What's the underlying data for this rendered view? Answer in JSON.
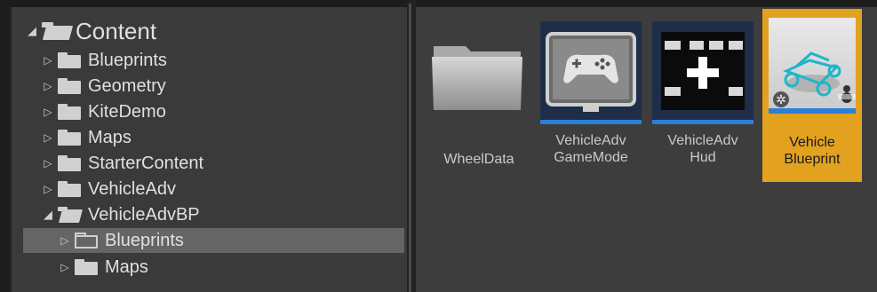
{
  "tree": {
    "root": {
      "label": "Content"
    },
    "items": [
      {
        "label": "Blueprints"
      },
      {
        "label": "Geometry"
      },
      {
        "label": "KiteDemo"
      },
      {
        "label": "Maps"
      },
      {
        "label": "StarterContent"
      },
      {
        "label": "VehicleAdv"
      },
      {
        "label": "VehicleAdvBP"
      }
    ],
    "sub_items": [
      {
        "label": "Blueprints"
      },
      {
        "label": "Maps"
      }
    ]
  },
  "assets": [
    {
      "label": "WheelData",
      "icon": "folder-icon"
    },
    {
      "label_line1": "VehicleAdv",
      "label_line2": "GameMode",
      "icon": "gamepad-icon"
    },
    {
      "label_line1": "VehicleAdv",
      "label_line2": "Hud",
      "icon": "hud-icon"
    },
    {
      "label_line1": "Vehicle",
      "label_line2": "Blueprint",
      "icon": "vehicle-icon"
    }
  ],
  "colors": {
    "selection": "#e2a11e",
    "accent_bar": "#2a7fd6",
    "tree_selected": "#656565"
  }
}
